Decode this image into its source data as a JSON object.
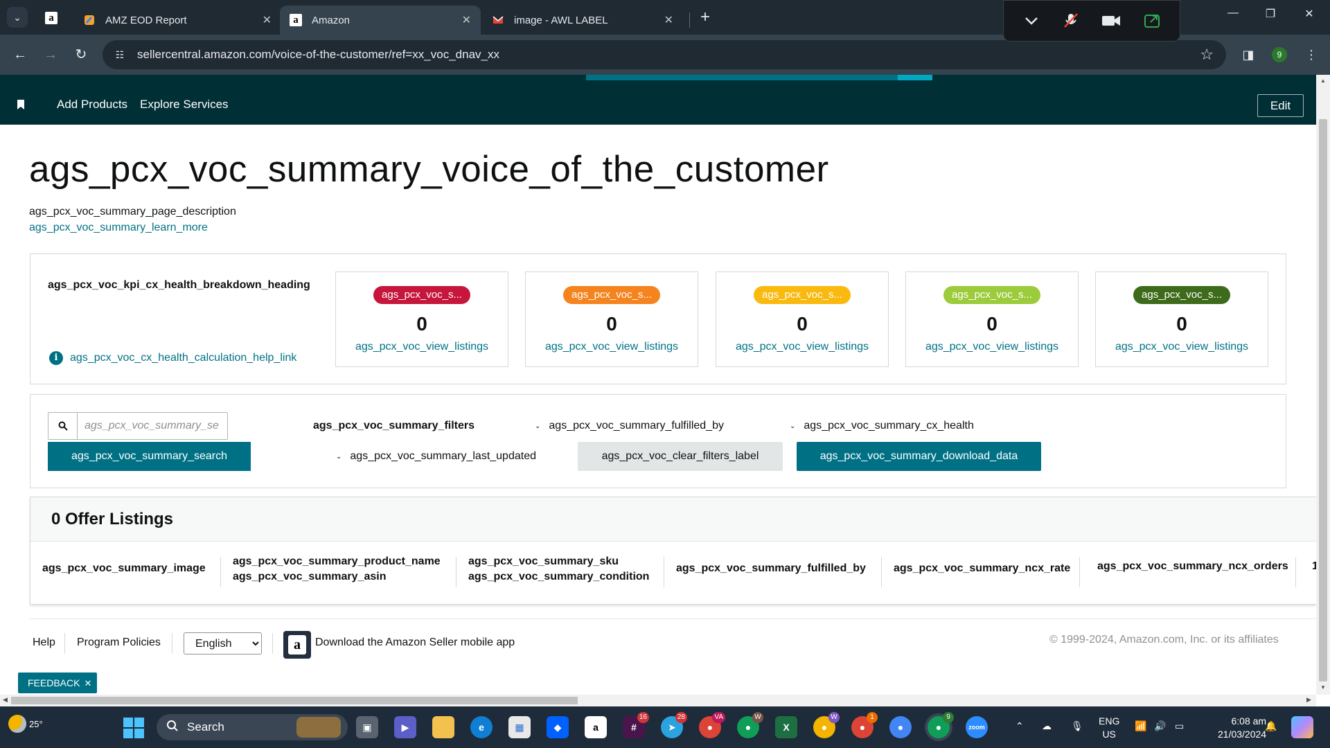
{
  "browser": {
    "tabs": [
      {
        "title": "AMZ EOD Report",
        "active": false
      },
      {
        "title": "Amazon",
        "active": true
      },
      {
        "title": "image - AWL LABEL",
        "active": false
      }
    ],
    "url": "sellercentral.amazon.com/voice-of-the-customer/ref=xx_voc_dnav_xx",
    "profile_initial": "9"
  },
  "navbar": {
    "links": [
      "Add Products",
      "Explore Services"
    ],
    "edit_label": "Edit"
  },
  "page": {
    "title": "ags_pcx_voc_summary_voice_of_the_customer",
    "description": "ags_pcx_voc_summary_page_description",
    "learn_more": "ags_pcx_voc_summary_learn_more"
  },
  "kpi": {
    "heading": "ags_pcx_voc_kpi_cx_health_breakdown_heading",
    "help_link": "ags_pcx_voc_cx_health_calculation_help_link",
    "cards": [
      {
        "pill": "ags_pcx_voc_s...",
        "color": "#c7163b",
        "value": "0",
        "link": "ags_pcx_voc_view_listings"
      },
      {
        "pill": "ags_pcx_voc_s...",
        "color": "#f5841f",
        "value": "0",
        "link": "ags_pcx_voc_view_listings"
      },
      {
        "pill": "ags_pcx_voc_s...",
        "color": "#f9b90f",
        "value": "0",
        "link": "ags_pcx_voc_view_listings"
      },
      {
        "pill": "ags_pcx_voc_s...",
        "color": "#9ccb3b",
        "value": "0",
        "link": "ags_pcx_voc_view_listings"
      },
      {
        "pill": "ags_pcx_voc_s...",
        "color": "#3e6b1b",
        "value": "0",
        "link": "ags_pcx_voc_view_listings"
      }
    ]
  },
  "filters": {
    "search_placeholder": "ags_pcx_voc_summary_se",
    "search_button": "ags_pcx_voc_summary_search",
    "filters_label": "ags_pcx_voc_summary_filters",
    "fulfilled_by": "ags_pcx_voc_summary_fulfilled_by",
    "cx_health": "ags_pcx_voc_summary_cx_health",
    "last_updated": "ags_pcx_voc_summary_last_updated",
    "clear_filters": "ags_pcx_voc_clear_filters_label",
    "download_data": "ags_pcx_voc_summary_download_data"
  },
  "listings": {
    "title": "0 Offer Listings",
    "columns": {
      "image": "ags_pcx_voc_summary_image",
      "product_name": "ags_pcx_voc_summary_product_name",
      "asin": "ags_pcx_voc_summary_asin",
      "sku": "ags_pcx_voc_summary_sku",
      "condition": "ags_pcx_voc_summary_condition",
      "fulfilled_by": "ags_pcx_voc_summary_fulfilled_by",
      "ncx_rate": "ags_pcx_voc_summary_ncx_rate",
      "ncx_orders": "ags_pcx_voc_summary_ncx_orders",
      "overflow": "1"
    }
  },
  "footer": {
    "help": "Help",
    "program_policies": "Program Policies",
    "language": "English",
    "app_text": "Download the Amazon Seller mobile app",
    "copyright": "© 1999-2024, Amazon.com, Inc. or its affiliates",
    "feedback": "FEEDBACK"
  },
  "taskbar": {
    "temperature": "25°",
    "search": "Search",
    "lang_top": "ENG",
    "lang_bottom": "US",
    "time": "6:08 am",
    "date": "21/03/2024",
    "badges": {
      "slack": "16",
      "telegram": "28",
      "chrome_va": "VA",
      "chrome_w": "W",
      "chrome_w2": "W",
      "chrome_1": "1",
      "chrome_9": "9"
    }
  }
}
